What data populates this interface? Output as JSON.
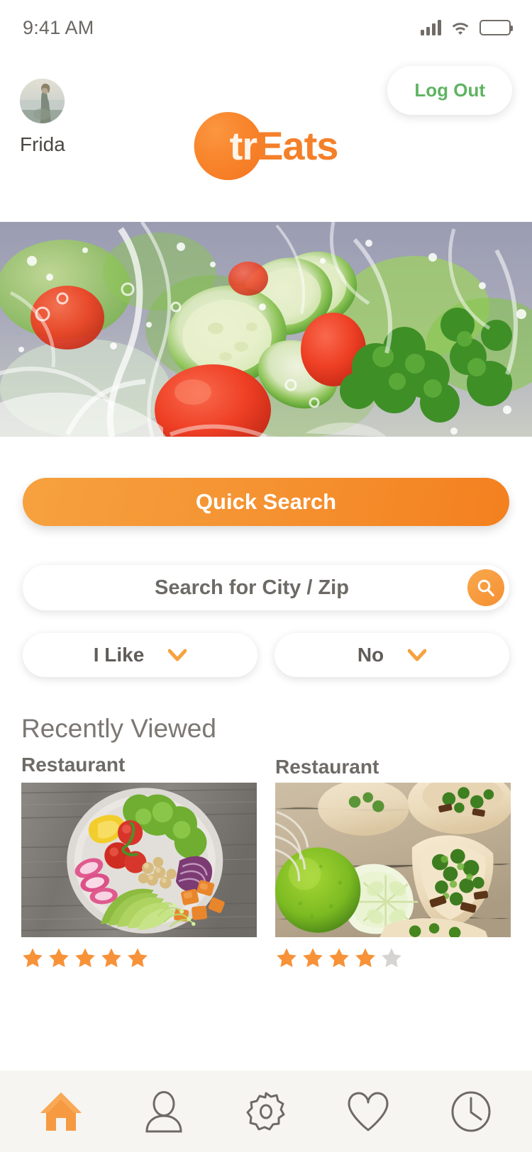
{
  "status_bar": {
    "time": "9:41 AM",
    "signal_icon": "signal-bars-icon",
    "wifi_icon": "wifi-icon",
    "battery_icon": "battery-full-icon"
  },
  "header": {
    "profile_name": "Frida",
    "avatar_icon": "avatar",
    "logout_label": "Log Out",
    "logo": {
      "part1": "tr",
      "part2": "Eats"
    }
  },
  "hero": {
    "alt": "fresh vegetables splashing in water"
  },
  "search": {
    "quick_search_label": "Quick Search",
    "city_zip_value": "",
    "city_zip_placeholder": "Search for City / Zip",
    "search_icon": "search-icon",
    "dropdowns": [
      {
        "label": "I Like",
        "icon": "chevron-down-icon"
      },
      {
        "label": "No",
        "icon": "chevron-down-icon"
      }
    ]
  },
  "recently_viewed": {
    "title": "Recently Viewed",
    "cards": [
      {
        "title": "Restaurant",
        "rating": 5,
        "max_rating": 5,
        "image_alt": "salad bowl with avocado and vegetables"
      },
      {
        "title": "Restaurant",
        "rating": 4,
        "max_rating": 5,
        "image_alt": "street tacos with lime"
      }
    ]
  },
  "bottom_nav": {
    "items": [
      {
        "name": "home",
        "icon": "home-icon",
        "active": true
      },
      {
        "name": "profile",
        "icon": "user-icon",
        "active": false
      },
      {
        "name": "settings",
        "icon": "gear-icon",
        "active": false
      },
      {
        "name": "favorites",
        "icon": "heart-icon",
        "active": false
      },
      {
        "name": "history",
        "icon": "clock-icon",
        "active": false
      }
    ]
  },
  "colors": {
    "accent_orange": "#f4802a",
    "logout_green": "#5fb462",
    "star_filled": "#f79239",
    "star_empty": "#d6d4d1",
    "text_gray": "#6e6a66",
    "nav_bg": "#f6f5f2"
  }
}
